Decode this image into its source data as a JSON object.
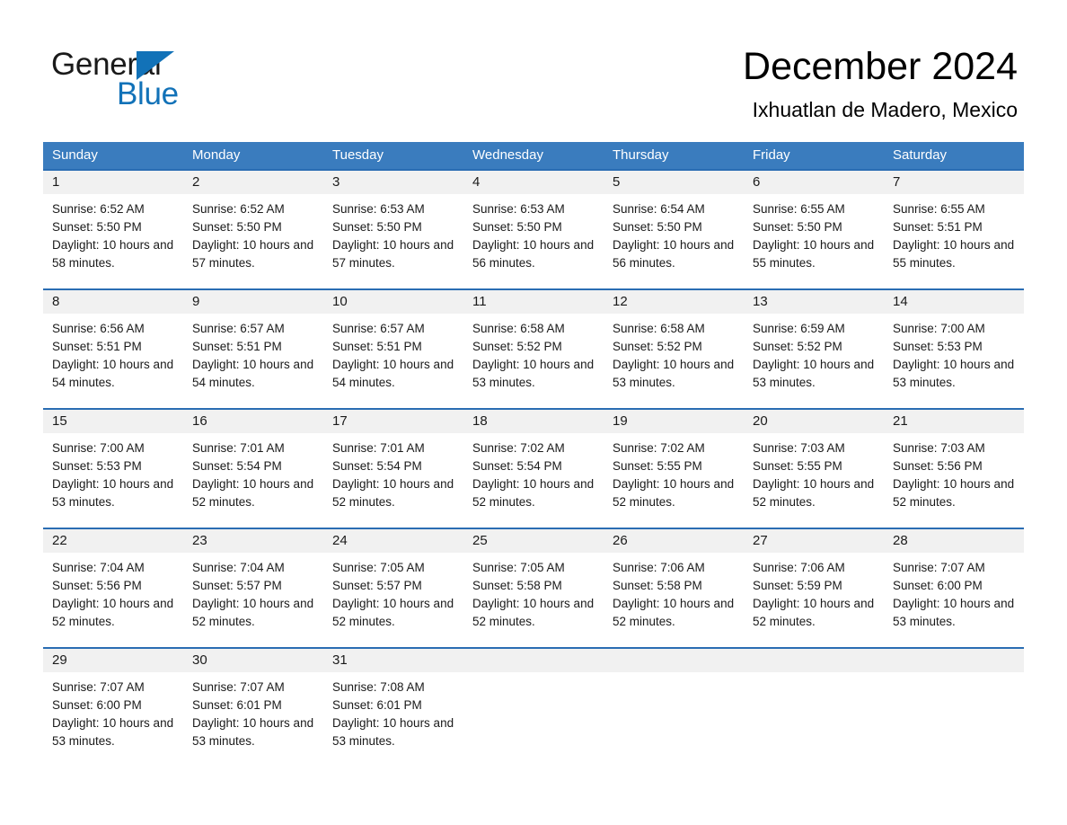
{
  "logo": {
    "word_one": "General",
    "word_two": "Blue",
    "triangle_color": "#1272b8"
  },
  "header": {
    "month_title": "December 2024",
    "location": "Ixhuatlan de Madero, Mexico"
  },
  "theme": {
    "header_blue": "#3a7cbe",
    "row_border_blue": "#2a6db3",
    "day_band_gray": "#f1f1f1"
  },
  "weekdays": [
    "Sunday",
    "Monday",
    "Tuesday",
    "Wednesday",
    "Thursday",
    "Friday",
    "Saturday"
  ],
  "weeks": [
    [
      {
        "day": "1",
        "sunrise": "Sunrise: 6:52 AM",
        "sunset": "Sunset: 5:50 PM",
        "daylight": "Daylight: 10 hours and 58 minutes."
      },
      {
        "day": "2",
        "sunrise": "Sunrise: 6:52 AM",
        "sunset": "Sunset: 5:50 PM",
        "daylight": "Daylight: 10 hours and 57 minutes."
      },
      {
        "day": "3",
        "sunrise": "Sunrise: 6:53 AM",
        "sunset": "Sunset: 5:50 PM",
        "daylight": "Daylight: 10 hours and 57 minutes."
      },
      {
        "day": "4",
        "sunrise": "Sunrise: 6:53 AM",
        "sunset": "Sunset: 5:50 PM",
        "daylight": "Daylight: 10 hours and 56 minutes."
      },
      {
        "day": "5",
        "sunrise": "Sunrise: 6:54 AM",
        "sunset": "Sunset: 5:50 PM",
        "daylight": "Daylight: 10 hours and 56 minutes."
      },
      {
        "day": "6",
        "sunrise": "Sunrise: 6:55 AM",
        "sunset": "Sunset: 5:50 PM",
        "daylight": "Daylight: 10 hours and 55 minutes."
      },
      {
        "day": "7",
        "sunrise": "Sunrise: 6:55 AM",
        "sunset": "Sunset: 5:51 PM",
        "daylight": "Daylight: 10 hours and 55 minutes."
      }
    ],
    [
      {
        "day": "8",
        "sunrise": "Sunrise: 6:56 AM",
        "sunset": "Sunset: 5:51 PM",
        "daylight": "Daylight: 10 hours and 54 minutes."
      },
      {
        "day": "9",
        "sunrise": "Sunrise: 6:57 AM",
        "sunset": "Sunset: 5:51 PM",
        "daylight": "Daylight: 10 hours and 54 minutes."
      },
      {
        "day": "10",
        "sunrise": "Sunrise: 6:57 AM",
        "sunset": "Sunset: 5:51 PM",
        "daylight": "Daylight: 10 hours and 54 minutes."
      },
      {
        "day": "11",
        "sunrise": "Sunrise: 6:58 AM",
        "sunset": "Sunset: 5:52 PM",
        "daylight": "Daylight: 10 hours and 53 minutes."
      },
      {
        "day": "12",
        "sunrise": "Sunrise: 6:58 AM",
        "sunset": "Sunset: 5:52 PM",
        "daylight": "Daylight: 10 hours and 53 minutes."
      },
      {
        "day": "13",
        "sunrise": "Sunrise: 6:59 AM",
        "sunset": "Sunset: 5:52 PM",
        "daylight": "Daylight: 10 hours and 53 minutes."
      },
      {
        "day": "14",
        "sunrise": "Sunrise: 7:00 AM",
        "sunset": "Sunset: 5:53 PM",
        "daylight": "Daylight: 10 hours and 53 minutes."
      }
    ],
    [
      {
        "day": "15",
        "sunrise": "Sunrise: 7:00 AM",
        "sunset": "Sunset: 5:53 PM",
        "daylight": "Daylight: 10 hours and 53 minutes."
      },
      {
        "day": "16",
        "sunrise": "Sunrise: 7:01 AM",
        "sunset": "Sunset: 5:54 PM",
        "daylight": "Daylight: 10 hours and 52 minutes."
      },
      {
        "day": "17",
        "sunrise": "Sunrise: 7:01 AM",
        "sunset": "Sunset: 5:54 PM",
        "daylight": "Daylight: 10 hours and 52 minutes."
      },
      {
        "day": "18",
        "sunrise": "Sunrise: 7:02 AM",
        "sunset": "Sunset: 5:54 PM",
        "daylight": "Daylight: 10 hours and 52 minutes."
      },
      {
        "day": "19",
        "sunrise": "Sunrise: 7:02 AM",
        "sunset": "Sunset: 5:55 PM",
        "daylight": "Daylight: 10 hours and 52 minutes."
      },
      {
        "day": "20",
        "sunrise": "Sunrise: 7:03 AM",
        "sunset": "Sunset: 5:55 PM",
        "daylight": "Daylight: 10 hours and 52 minutes."
      },
      {
        "day": "21",
        "sunrise": "Sunrise: 7:03 AM",
        "sunset": "Sunset: 5:56 PM",
        "daylight": "Daylight: 10 hours and 52 minutes."
      }
    ],
    [
      {
        "day": "22",
        "sunrise": "Sunrise: 7:04 AM",
        "sunset": "Sunset: 5:56 PM",
        "daylight": "Daylight: 10 hours and 52 minutes."
      },
      {
        "day": "23",
        "sunrise": "Sunrise: 7:04 AM",
        "sunset": "Sunset: 5:57 PM",
        "daylight": "Daylight: 10 hours and 52 minutes."
      },
      {
        "day": "24",
        "sunrise": "Sunrise: 7:05 AM",
        "sunset": "Sunset: 5:57 PM",
        "daylight": "Daylight: 10 hours and 52 minutes."
      },
      {
        "day": "25",
        "sunrise": "Sunrise: 7:05 AM",
        "sunset": "Sunset: 5:58 PM",
        "daylight": "Daylight: 10 hours and 52 minutes."
      },
      {
        "day": "26",
        "sunrise": "Sunrise: 7:06 AM",
        "sunset": "Sunset: 5:58 PM",
        "daylight": "Daylight: 10 hours and 52 minutes."
      },
      {
        "day": "27",
        "sunrise": "Sunrise: 7:06 AM",
        "sunset": "Sunset: 5:59 PM",
        "daylight": "Daylight: 10 hours and 52 minutes."
      },
      {
        "day": "28",
        "sunrise": "Sunrise: 7:07 AM",
        "sunset": "Sunset: 6:00 PM",
        "daylight": "Daylight: 10 hours and 53 minutes."
      }
    ],
    [
      {
        "day": "29",
        "sunrise": "Sunrise: 7:07 AM",
        "sunset": "Sunset: 6:00 PM",
        "daylight": "Daylight: 10 hours and 53 minutes."
      },
      {
        "day": "30",
        "sunrise": "Sunrise: 7:07 AM",
        "sunset": "Sunset: 6:01 PM",
        "daylight": "Daylight: 10 hours and 53 minutes."
      },
      {
        "day": "31",
        "sunrise": "Sunrise: 7:08 AM",
        "sunset": "Sunset: 6:01 PM",
        "daylight": "Daylight: 10 hours and 53 minutes."
      },
      {
        "day": "",
        "sunrise": "",
        "sunset": "",
        "daylight": ""
      },
      {
        "day": "",
        "sunrise": "",
        "sunset": "",
        "daylight": ""
      },
      {
        "day": "",
        "sunrise": "",
        "sunset": "",
        "daylight": ""
      },
      {
        "day": "",
        "sunrise": "",
        "sunset": "",
        "daylight": ""
      }
    ]
  ]
}
